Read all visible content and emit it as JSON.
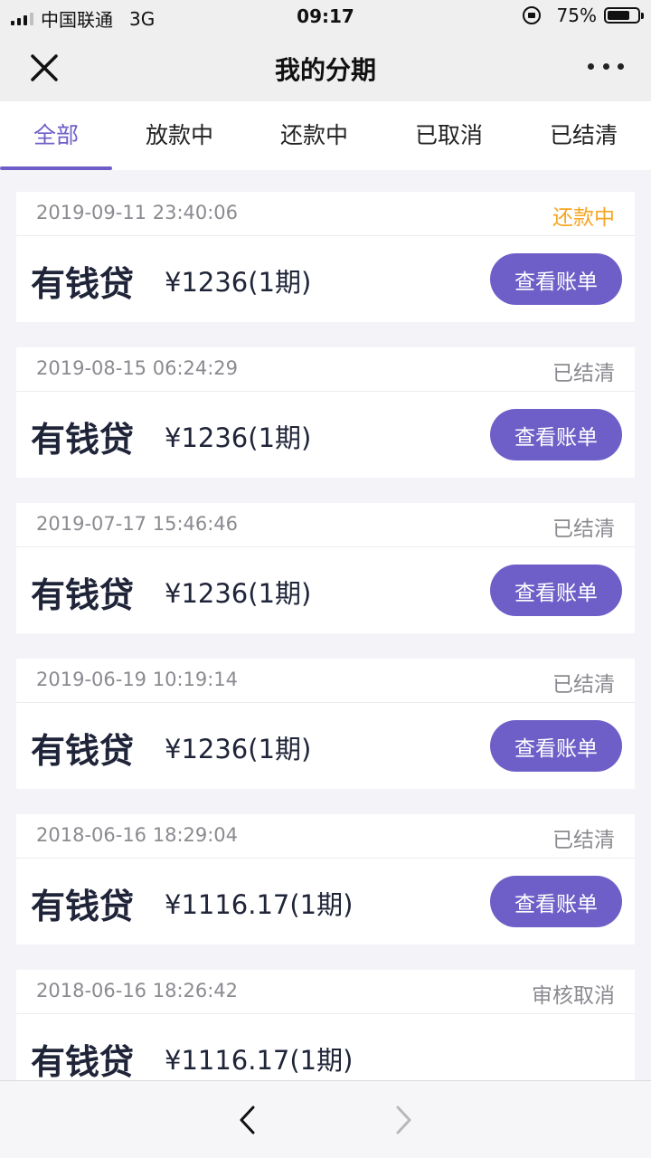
{
  "status_bar": {
    "carrier": "中国联通",
    "network": "3G",
    "time": "09:17",
    "battery": "75%",
    "battery_level": 0.75
  },
  "nav": {
    "title": "我的分期",
    "close_icon": "close-icon",
    "more_icon": "more-icon"
  },
  "tabs": [
    {
      "label": "全部",
      "active": true
    },
    {
      "label": "放款中",
      "active": false
    },
    {
      "label": "还款中",
      "active": false
    },
    {
      "label": "已取消",
      "active": false
    },
    {
      "label": "已结清",
      "active": false
    }
  ],
  "loans": [
    {
      "date": "2019-09-11 23:40:06",
      "status": "还款中",
      "name": "有钱贷",
      "amount": "¥1236(1期)",
      "button": "查看账单"
    },
    {
      "date": "2019-08-15 06:24:29",
      "status": "已结清",
      "name": "有钱贷",
      "amount": "¥1236(1期)",
      "button": "查看账单"
    },
    {
      "date": "2019-07-17 15:46:46",
      "status": "已结清",
      "name": "有钱贷",
      "amount": "¥1236(1期)",
      "button": "查看账单"
    },
    {
      "date": "2019-06-19 10:19:14",
      "status": "已结清",
      "name": "有钱贷",
      "amount": "¥1236(1期)",
      "button": "查看账单"
    },
    {
      "date": "2018-06-16 18:29:04",
      "status": "已结清",
      "name": "有钱贷",
      "amount": "¥1116.17(1期)",
      "button": "查看账单"
    },
    {
      "date": "2018-06-16 18:26:42",
      "status": "审核取消",
      "name": "有钱贷",
      "amount": "¥1116.17(1期)",
      "button": ""
    }
  ],
  "colors": {
    "accent": "#6e5fc8",
    "repaying_status": "#f5a623",
    "muted_status": "#8a8a90"
  },
  "bottom_bar": {
    "back_icon": "back-arrow-icon",
    "forward_icon": "forward-arrow-icon"
  }
}
